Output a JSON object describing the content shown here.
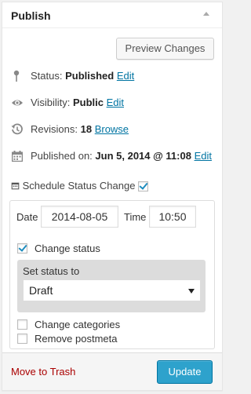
{
  "header": {
    "title": "Publish"
  },
  "preview_button": "Preview Changes",
  "status": {
    "label": "Status:",
    "value": "Published",
    "edit": "Edit",
    "icon": "pin-icon"
  },
  "visibility": {
    "label": "Visibility:",
    "value": "Public",
    "edit": "Edit",
    "icon": "eye-icon"
  },
  "revisions": {
    "label": "Revisions:",
    "value": "18",
    "link": "Browse",
    "icon": "history-icon"
  },
  "published": {
    "label": "Published on:",
    "value": "Jun 5, 2014 @ 11:08",
    "edit": "Edit",
    "icon": "calendar-icon"
  },
  "schedule": {
    "label": "Schedule Status Change",
    "checked": true,
    "icon": "calendar-small-icon"
  },
  "panel": {
    "date_label": "Date",
    "date_value": "2014-08-05",
    "time_label": "Time",
    "time_value": "10:50",
    "change_status_label": "Change status",
    "change_status_checked": true,
    "set_status_label": "Set status to",
    "status_selected": "Draft",
    "change_categories_label": "Change categories",
    "change_categories_checked": false,
    "remove_postmeta_label": "Remove postmeta",
    "remove_postmeta_checked": false
  },
  "footer": {
    "trash": "Move to Trash",
    "update": "Update"
  },
  "colors": {
    "link": "#0074a2",
    "trash": "#aa0000",
    "primary": "#2ea2cc",
    "checkmark": "#1e8cbe"
  }
}
